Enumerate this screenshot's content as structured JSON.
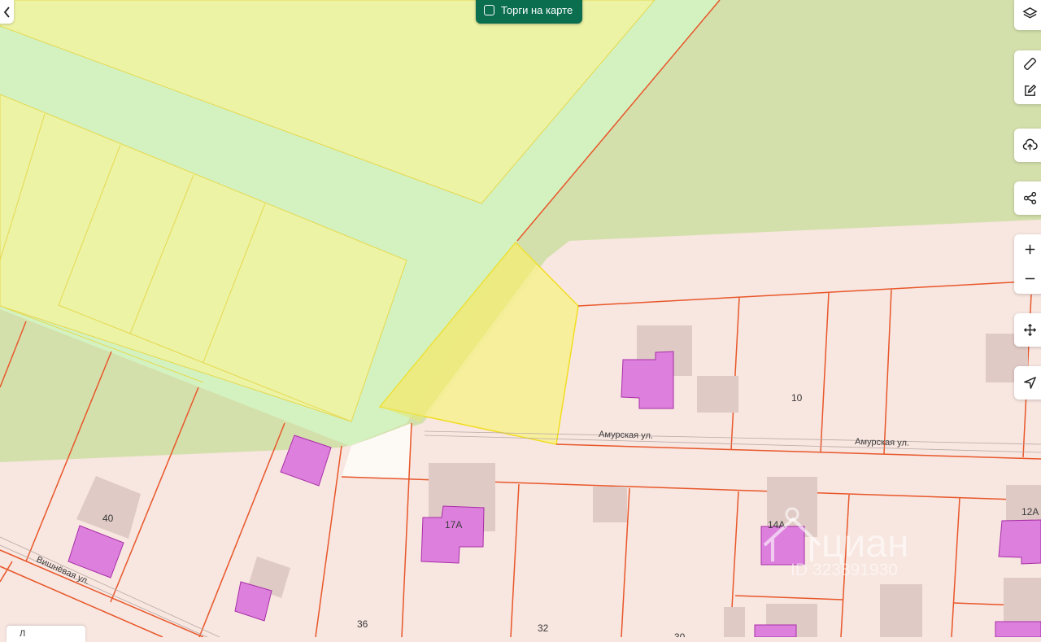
{
  "toolbar": {
    "auction_toggle_label": "Торги на карте"
  },
  "streets": {
    "amurskaya_1": "Амурская ул.",
    "amurskaya_2": "Амурская ул.",
    "vishnevaya": "Вишнёвая ул."
  },
  "house_numbers": {
    "h10": "10",
    "h40": "40",
    "h17a": "17А",
    "h14a": "14А",
    "h12a": "12А",
    "h36": "36",
    "h32": "32",
    "h30": "30"
  },
  "watermark": {
    "brand": "циан",
    "listing_id": "ID 323891930"
  },
  "bottom_tag": {
    "label": "Л"
  },
  "controls": [
    "layers-icon",
    "ruler-icon",
    "edit-icon",
    "cloud-upload-icon",
    "share-icon",
    "zoom-in-icon",
    "zoom-out-icon",
    "move-icon",
    "locate-icon"
  ],
  "colors": {
    "residential": "#f8e6e0",
    "forest": "#d4e0ac",
    "meadow": "#d3f2c0",
    "plot_yellow": "#ecf3a4",
    "selected_plot": "#f7ef96",
    "building": "#dd80dd",
    "boundary": "#e8572a",
    "accent": "#0b6e4f"
  }
}
